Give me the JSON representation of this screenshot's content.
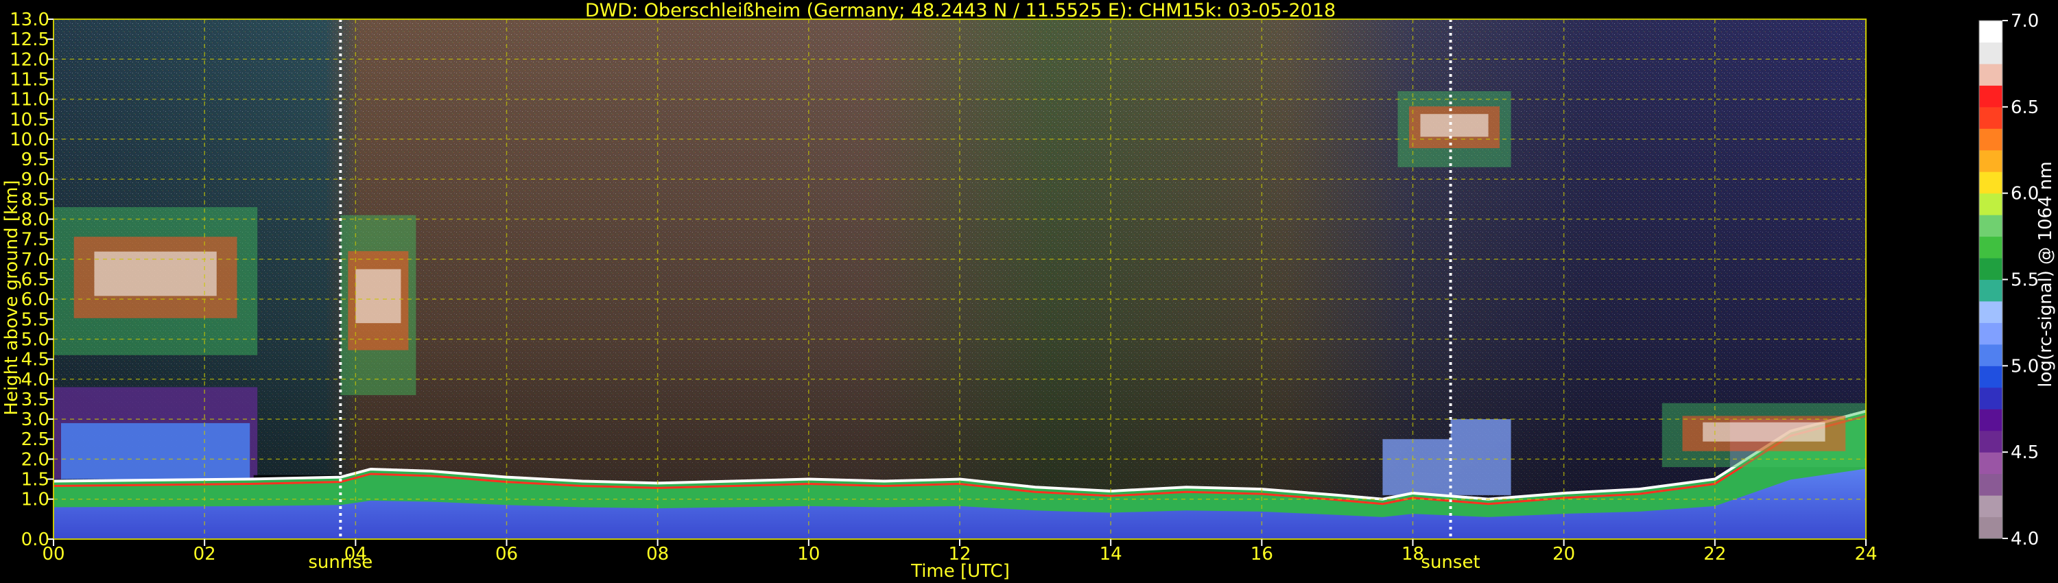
{
  "chart_data": {
    "type": "heatmap",
    "title": "DWD: Oberschleißheim (Germany; 48.2443 N / 11.5525 E):    CHM15k: 03-05-2018",
    "xlabel": "Time [UTC]",
    "ylabel": "Height above ground [km]",
    "x_ticks": [
      "00",
      "02",
      "04",
      "06",
      "08",
      "10",
      "12",
      "14",
      "16",
      "18",
      "20",
      "22",
      "24"
    ],
    "y_ticks": [
      "0.0",
      "1.0",
      "1.5",
      "2.0",
      "2.5",
      "3.0",
      "3.5",
      "4.0",
      "4.5",
      "5.0",
      "5.5",
      "6.0",
      "6.5",
      "7.0",
      "7.5",
      "8.0",
      "8.5",
      "9.0",
      "9.5",
      "10.0",
      "10.5",
      "11.0",
      "11.5",
      "12.0",
      "12.5",
      "13.0"
    ],
    "xlim": [
      0,
      24
    ],
    "ylim": [
      0,
      13
    ],
    "grid": true,
    "annotations": [
      {
        "label": "sunrise",
        "x": 3.8
      },
      {
        "label": "sunset",
        "x": 18.5
      }
    ],
    "colorbar": {
      "label": "log(rc-signal) @ 1064 nm",
      "range": [
        4.0,
        7.0
      ],
      "ticks": [
        "4.0",
        "4.5",
        "5.0",
        "5.5",
        "6.0",
        "6.5",
        "7.0"
      ],
      "colors": [
        "#a08a9a",
        "#b09aac",
        "#8a5a95",
        "#9a55a5",
        "#6a2890",
        "#5a1095",
        "#3030c0",
        "#2050e0",
        "#5080f0",
        "#80a0ff",
        "#a0c0ff",
        "#30b090",
        "#20a040",
        "#40c040",
        "#70d070",
        "#c0f040",
        "#ffe020",
        "#ffb020",
        "#ff8020",
        "#ff4020",
        "#ff2020",
        "#f0c0b0",
        "#e8e8e8",
        "#ffffff"
      ]
    },
    "boundary_layer_top_km": [
      {
        "x": 0.0,
        "y": 1.45
      },
      {
        "x": 2.6,
        "y": 1.5
      },
      {
        "x": 3.8,
        "y": 1.55
      },
      {
        "x": 4.2,
        "y": 1.75
      },
      {
        "x": 5.0,
        "y": 1.7
      },
      {
        "x": 6.0,
        "y": 1.55
      },
      {
        "x": 7.0,
        "y": 1.45
      },
      {
        "x": 8.0,
        "y": 1.4
      },
      {
        "x": 9.0,
        "y": 1.45
      },
      {
        "x": 10.0,
        "y": 1.5
      },
      {
        "x": 11.0,
        "y": 1.45
      },
      {
        "x": 12.0,
        "y": 1.5
      },
      {
        "x": 13.0,
        "y": 1.3
      },
      {
        "x": 14.0,
        "y": 1.2
      },
      {
        "x": 15.0,
        "y": 1.3
      },
      {
        "x": 16.0,
        "y": 1.25
      },
      {
        "x": 17.0,
        "y": 1.1
      },
      {
        "x": 17.6,
        "y": 1.0
      },
      {
        "x": 18.0,
        "y": 1.15
      },
      {
        "x": 19.0,
        "y": 1.0
      },
      {
        "x": 20.0,
        "y": 1.15
      },
      {
        "x": 21.0,
        "y": 1.25
      },
      {
        "x": 22.0,
        "y": 1.5
      },
      {
        "x": 23.0,
        "y": 2.7
      },
      {
        "x": 24.0,
        "y": 3.2
      }
    ],
    "cloud_layers_km": [
      {
        "x_start": 0.0,
        "x_end": 2.7,
        "y_bottom": 4.6,
        "y_top": 8.3
      },
      {
        "x_start": 3.8,
        "x_end": 4.8,
        "y_bottom": 3.6,
        "y_top": 8.1
      },
      {
        "x_start": 17.8,
        "x_end": 19.3,
        "y_bottom": 9.3,
        "y_top": 11.2
      },
      {
        "x_start": 21.3,
        "x_end": 24.0,
        "y_bottom": 1.8,
        "y_top": 3.4
      }
    ]
  }
}
